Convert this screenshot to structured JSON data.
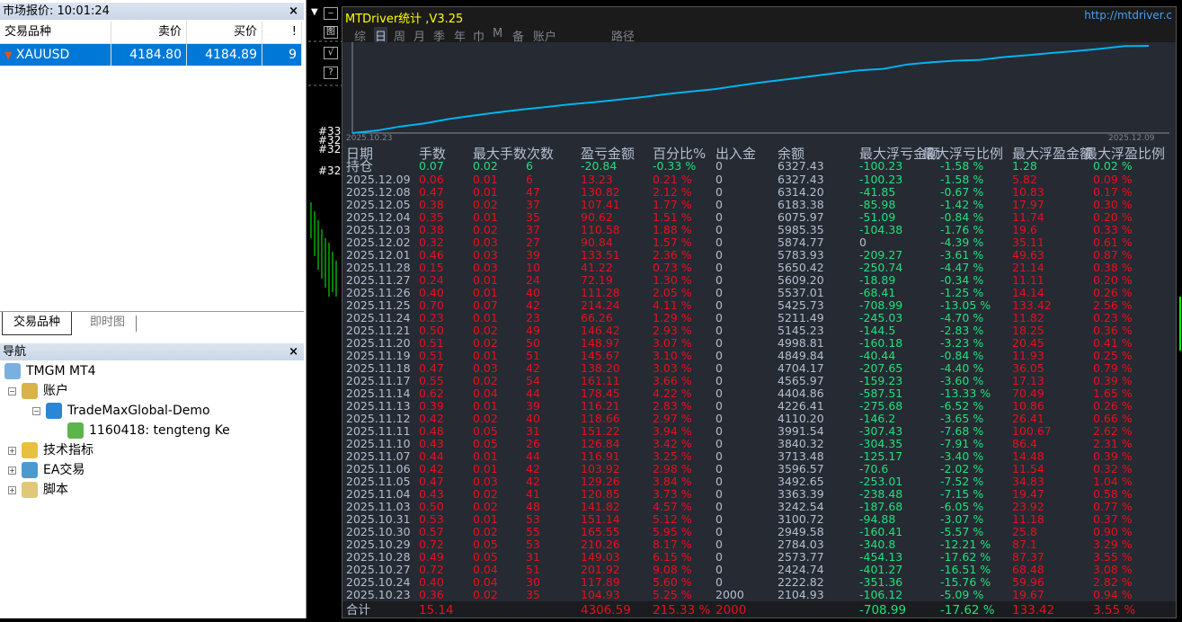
{
  "market_watch": {
    "title": "市场报价: 10:01:24",
    "close": "×",
    "headers": [
      "交易品种",
      "卖价",
      "买价",
      "!"
    ],
    "row": {
      "symbol": "XAUUSD",
      "bid": "4184.80",
      "ask": "4184.89",
      "spread": "9"
    }
  },
  "tabs": [
    "交易品种",
    "即时图"
  ],
  "navigator": {
    "title": "导航",
    "close": "×",
    "items": [
      {
        "label": "TMGM MT4",
        "indent": 0,
        "pm": "",
        "color": "#7ab0e0"
      },
      {
        "label": "账户",
        "indent": 1,
        "pm": "−",
        "color": "#d9b24a"
      },
      {
        "label": "TradeMaxGlobal-Demo",
        "indent": 2,
        "pm": "−",
        "color": "#2a86d8"
      },
      {
        "label": "1160418: tengteng Ke",
        "indent": 3,
        "pm": "",
        "color": "#5cb54a"
      },
      {
        "label": "技术指标",
        "indent": 1,
        "pm": "+",
        "color": "#e8c040"
      },
      {
        "label": "EA交易",
        "indent": 1,
        "pm": "+",
        "color": "#4a9ad0"
      },
      {
        "label": "脚本",
        "indent": 1,
        "pm": "+",
        "color": "#e0c878"
      }
    ]
  },
  "side_buttons": [
    "‒",
    "图",
    "√",
    "?"
  ],
  "side_labels": [
    "#33",
    "#32",
    "#32",
    "#32"
  ],
  "panel": {
    "title": "MTDriver统计 ,V3.25",
    "url": "http://mtdriver.c",
    "menu": [
      "综",
      "日",
      "周",
      "月",
      "季",
      "年",
      "巾",
      "M",
      "备",
      "账户",
      "路径"
    ],
    "selected_menu": "日",
    "chart_start": "2025.10.23",
    "chart_end": "2025.12.09",
    "line_color": "#00b4f0"
  },
  "table": {
    "headers": [
      "日期",
      "手数",
      "最大手数",
      "次数",
      "盈亏金额",
      "百分比%",
      "出入金",
      "余额",
      "最大浮亏金额",
      "最大浮亏比例",
      "最大浮盈金额",
      "最大浮盈比例"
    ],
    "open": [
      "持仓",
      "0.07",
      "0.02",
      "6",
      "-20.84",
      "-0.33 %",
      "0",
      "6327.43",
      "-100.23",
      "-1.58 %",
      "1.28",
      "0.02 %"
    ],
    "rows": [
      [
        "2025.12.09",
        "0.06",
        "0.01",
        "6",
        "13.23",
        "0.21 %",
        "0",
        "6327.43",
        "-100.23",
        "-1.58 %",
        "5.82",
        "0.09 %"
      ],
      [
        "2025.12.08",
        "0.47",
        "0.01",
        "47",
        "130.82",
        "2.12 %",
        "0",
        "6314.20",
        "-41.85",
        "-0.67 %",
        "10.83",
        "0.17 %"
      ],
      [
        "2025.12.05",
        "0.38",
        "0.02",
        "37",
        "107.41",
        "1.77 %",
        "0",
        "6183.38",
        "-85.98",
        "-1.42 %",
        "17.97",
        "0.30 %"
      ],
      [
        "2025.12.04",
        "0.35",
        "0.01",
        "35",
        "90.62",
        "1.51 %",
        "0",
        "6075.97",
        "-51.09",
        "-0.84 %",
        "11.74",
        "0.20 %"
      ],
      [
        "2025.12.03",
        "0.38",
        "0.02",
        "37",
        "110.58",
        "1.88 %",
        "0",
        "5985.35",
        "-104.38",
        "-1.76 %",
        "19.6",
        "0.33 %"
      ],
      [
        "2025.12.02",
        "0.32",
        "0.03",
        "27",
        "90.84",
        "1.57 %",
        "0",
        "5874.77",
        "0",
        "-4.39 %",
        "35.11",
        "0.61 %"
      ],
      [
        "2025.12.01",
        "0.46",
        "0.03",
        "39",
        "133.51",
        "2.36 %",
        "0",
        "5783.93",
        "-209.27",
        "-3.61 %",
        "49.63",
        "0.87 %"
      ],
      [
        "2025.11.28",
        "0.15",
        "0.03",
        "10",
        "41.22",
        "0.73 %",
        "0",
        "5650.42",
        "-250.74",
        "-4.47 %",
        "21.14",
        "0.38 %"
      ],
      [
        "2025.11.27",
        "0.24",
        "0.01",
        "24",
        "72.19",
        "1.30 %",
        "0",
        "5609.20",
        "-18.89",
        "-0.34 %",
        "11.11",
        "0.20 %"
      ],
      [
        "2025.11.26",
        "0.40",
        "0.01",
        "40",
        "111.28",
        "2.05 %",
        "0",
        "5537.01",
        "-68.41",
        "-1.25 %",
        "14.14",
        "0.26 %"
      ],
      [
        "2025.11.25",
        "0.70",
        "0.07",
        "42",
        "214.24",
        "4.11 %",
        "0",
        "5425.73",
        "-708.99",
        "-13.05 %",
        "133.42",
        "2.56 %"
      ],
      [
        "2025.11.24",
        "0.23",
        "0.01",
        "23",
        "66.26",
        "1.29 %",
        "0",
        "5211.49",
        "-245.03",
        "-4.70 %",
        "11.82",
        "0.23 %"
      ],
      [
        "2025.11.21",
        "0.50",
        "0.02",
        "49",
        "146.42",
        "2.93 %",
        "0",
        "5145.23",
        "-144.5",
        "-2.83 %",
        "18.25",
        "0.36 %"
      ],
      [
        "2025.11.20",
        "0.51",
        "0.02",
        "50",
        "148.97",
        "3.07 %",
        "0",
        "4998.81",
        "-160.18",
        "-3.23 %",
        "20.45",
        "0.41 %"
      ],
      [
        "2025.11.19",
        "0.51",
        "0.01",
        "51",
        "145.67",
        "3.10 %",
        "0",
        "4849.84",
        "-40.44",
        "-0.84 %",
        "11.93",
        "0.25 %"
      ],
      [
        "2025.11.18",
        "0.47",
        "0.03",
        "42",
        "138.20",
        "3.03 %",
        "0",
        "4704.17",
        "-207.65",
        "-4.40 %",
        "36.05",
        "0.79 %"
      ],
      [
        "2025.11.17",
        "0.55",
        "0.02",
        "54",
        "161.11",
        "3.66 %",
        "0",
        "4565.97",
        "-159.23",
        "-3.60 %",
        "17.13",
        "0.39 %"
      ],
      [
        "2025.11.14",
        "0.62",
        "0.04",
        "44",
        "178.45",
        "4.22 %",
        "0",
        "4404.86",
        "-587.51",
        "-13.33 %",
        "70.49",
        "1.65 %"
      ],
      [
        "2025.11.13",
        "0.39",
        "0.01",
        "39",
        "116.21",
        "2.83 %",
        "0",
        "4226.41",
        "-275.68",
        "-6.52 %",
        "10.86",
        "0.26 %"
      ],
      [
        "2025.11.12",
        "0.42",
        "0.02",
        "40",
        "118.66",
        "2.97 %",
        "0",
        "4110.20",
        "-146.2",
        "-3.65 %",
        "26.41",
        "0.66 %"
      ],
      [
        "2025.11.11",
        "0.48",
        "0.05",
        "31",
        "151.22",
        "3.94 %",
        "0",
        "3991.54",
        "-307.43",
        "-7.68 %",
        "100.67",
        "2.62 %"
      ],
      [
        "2025.11.10",
        "0.43",
        "0.05",
        "26",
        "126.84",
        "3.42 %",
        "0",
        "3840.32",
        "-304.35",
        "-7.91 %",
        "86.4",
        "2.31 %"
      ],
      [
        "2025.11.07",
        "0.44",
        "0.01",
        "44",
        "116.91",
        "3.25 %",
        "0",
        "3713.48",
        "-125.17",
        "-3.40 %",
        "14.48",
        "0.39 %"
      ],
      [
        "2025.11.06",
        "0.42",
        "0.01",
        "42",
        "103.92",
        "2.98 %",
        "0",
        "3596.57",
        "-70.6",
        "-2.02 %",
        "11.54",
        "0.32 %"
      ],
      [
        "2025.11.05",
        "0.47",
        "0.03",
        "42",
        "129.26",
        "3.84 %",
        "0",
        "3492.65",
        "-253.01",
        "-7.52 %",
        "34.83",
        "1.04 %"
      ],
      [
        "2025.11.04",
        "0.43",
        "0.02",
        "41",
        "120.85",
        "3.73 %",
        "0",
        "3363.39",
        "-238.48",
        "-7.15 %",
        "19.47",
        "0.58 %"
      ],
      [
        "2025.11.03",
        "0.50",
        "0.02",
        "48",
        "141.82",
        "4.57 %",
        "0",
        "3242.54",
        "-187.68",
        "-6.05 %",
        "23.92",
        "0.77 %"
      ],
      [
        "2025.10.31",
        "0.53",
        "0.01",
        "53",
        "151.14",
        "5.12 %",
        "0",
        "3100.72",
        "-94.88",
        "-3.07 %",
        "11.18",
        "0.37 %"
      ],
      [
        "2025.10.30",
        "0.57",
        "0.02",
        "55",
        "165.55",
        "5.95 %",
        "0",
        "2949.58",
        "-160.41",
        "-5.57 %",
        "25.8",
        "0.90 %"
      ],
      [
        "2025.10.29",
        "0.72",
        "0.05",
        "53",
        "210.26",
        "8.17 %",
        "0",
        "2784.03",
        "-340.8",
        "-12.21 %",
        "87.1",
        "3.29 %"
      ],
      [
        "2025.10.28",
        "0.49",
        "0.05",
        "31",
        "149.03",
        "6.15 %",
        "0",
        "2573.77",
        "-454.13",
        "-17.62 %",
        "87.37",
        "3.55 %"
      ],
      [
        "2025.10.27",
        "0.72",
        "0.04",
        "51",
        "201.92",
        "9.08 %",
        "0",
        "2424.74",
        "-401.27",
        "-16.51 %",
        "68.48",
        "3.08 %"
      ],
      [
        "2025.10.24",
        "0.40",
        "0.04",
        "30",
        "117.89",
        "5.60 %",
        "0",
        "2222.82",
        "-351.36",
        "-15.76 %",
        "59.96",
        "2.82 %"
      ],
      [
        "2025.10.23",
        "0.36",
        "0.02",
        "35",
        "104.93",
        "5.25 %",
        "2000",
        "2104.93",
        "-106.12",
        "-5.09 %",
        "19.67",
        "0.94 %"
      ]
    ],
    "total": [
      "合计",
      "15.14",
      "",
      "",
      "4306.59",
      "215.33 %",
      "2000",
      "",
      "-708.99",
      "-17.62 %",
      "133.42",
      "3.55 %"
    ]
  },
  "colors": {
    "red": "#e8101c",
    "green": "#22e07a",
    "neutral": "#b4bfcf",
    "title": "#ffff00"
  }
}
